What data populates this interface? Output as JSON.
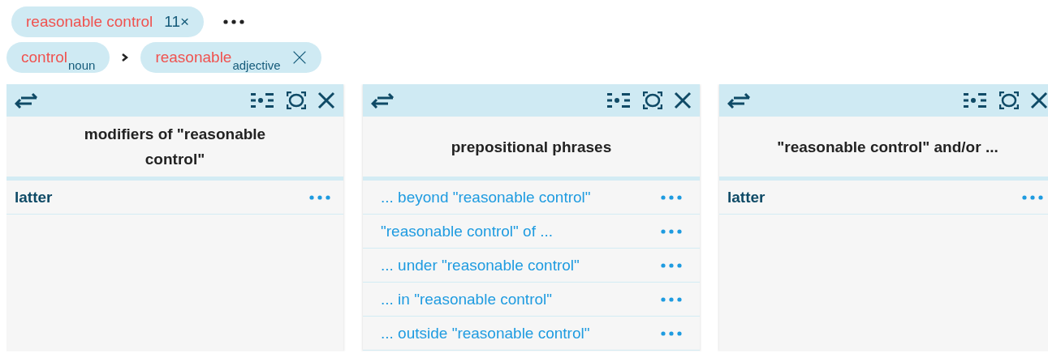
{
  "query": {
    "text": "reasonable control",
    "count": "11×"
  },
  "path": [
    {
      "word": "control",
      "pos": "noun",
      "closable": false
    },
    {
      "word": "reasonable",
      "pos": "adjective",
      "closable": true
    }
  ],
  "panels": [
    {
      "title": "modifiers of \"reasonable control\"",
      "items": [
        {
          "kind": "word",
          "text": "latter"
        }
      ]
    },
    {
      "title": "prepositional phrases",
      "items": [
        {
          "kind": "phrase",
          "text": "... beyond \"reasonable control\""
        },
        {
          "kind": "phrase",
          "text": "\"reasonable control\" of ..."
        },
        {
          "kind": "phrase",
          "text": "... under \"reasonable control\""
        },
        {
          "kind": "phrase",
          "text": "... in \"reasonable control\""
        },
        {
          "kind": "phrase",
          "text": "... outside \"reasonable control\""
        }
      ]
    },
    {
      "title": "\"reasonable control\" and/or ...",
      "items": [
        {
          "kind": "word",
          "text": "latter"
        }
      ]
    }
  ]
}
